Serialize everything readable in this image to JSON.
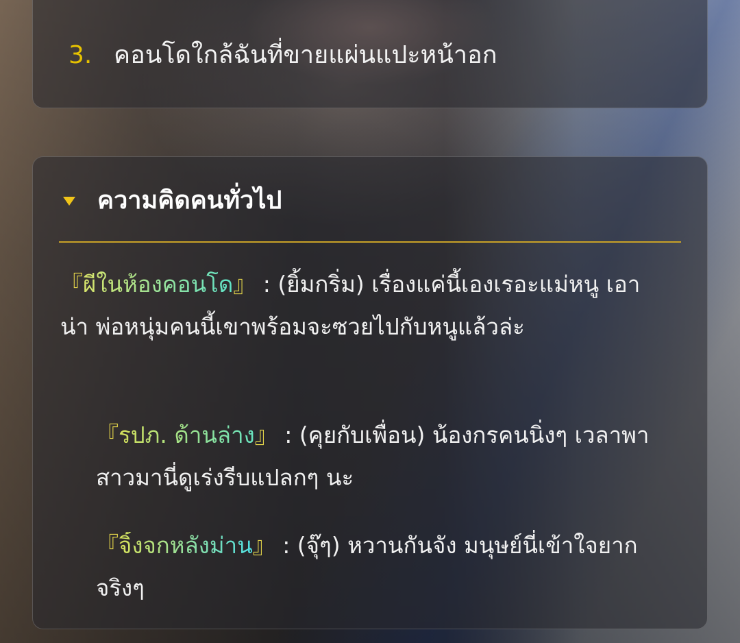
{
  "top_list": {
    "item_number": "3.",
    "item_text": "คอนโดใกล้ฉันที่ขายแผ่นแปะหน้าอก"
  },
  "section": {
    "title": "ความคิดคนทั่วไป",
    "comments": [
      {
        "open_bracket": "『",
        "name": "ผีในห้องคอนโด",
        "close_bracket": "』",
        "text": " : (ยิ้มกริ่ม) เรื่องแค่นี้เองเรอะแม่หนู เอาน่า พ่อหนุ่มคนนี้เขาพร้อมจะซวยไปกับหนูแล้วล่ะ"
      },
      {
        "open_bracket": "『",
        "name": "รปภ. ด้านล่าง",
        "close_bracket": "』",
        "text": " : (คุยกับเพื่อน) น้องกรคนนิ่งๆ เวลาพาสาวมานี่ดูเร่งรีบแปลกๆ นะ"
      },
      {
        "open_bracket": "『",
        "name": "จิ้งจกหลังม่าน",
        "close_bracket": "』",
        "text": " : (จุ๊ๆ) หวานกันจัง มนุษย์นี่เข้าใจยากจริงๆ"
      }
    ]
  },
  "colors": {
    "accent_gold": "#f0c419",
    "divider": "#c9a227",
    "name_gradient_start": "#d8e46a",
    "name_gradient_end": "#5fe3c8"
  }
}
